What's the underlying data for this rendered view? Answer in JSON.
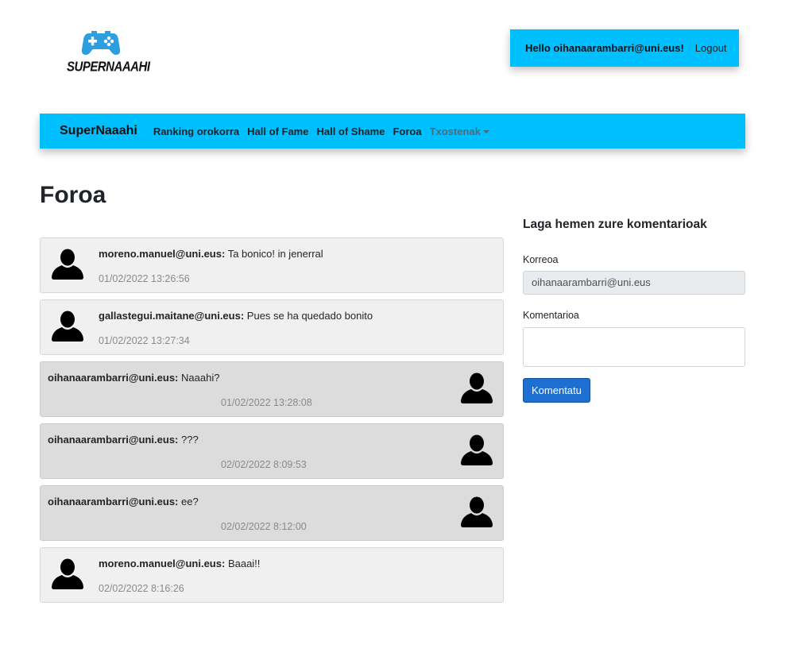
{
  "logo": {
    "text": "SUPERNAAAHI",
    "icon": "gamepad-icon",
    "color": "#2d9ee0"
  },
  "user": {
    "hello": "Hello oihanaarambarri@uni.eus!",
    "logout": "Logout"
  },
  "nav": {
    "brand": "SuperNaaahi",
    "links": [
      "Ranking orokorra",
      "Hall of Fame",
      "Hall of Shame",
      "Foroa"
    ],
    "dropdown": "Txostenak",
    "color": "#00bfff"
  },
  "page": {
    "title": "Foroa"
  },
  "posts": [
    {
      "author": "moreno.manuel@uni.eus:",
      "text": "Ta bonico! in jenerral",
      "time": "01/02/2022 13:26:56",
      "own": false
    },
    {
      "author": "gallastegui.maitane@uni.eus:",
      "text": "Pues se ha quedado bonito",
      "time": "01/02/2022 13:27:34",
      "own": false
    },
    {
      "author": "oihanaarambarri@uni.eus:",
      "text": "Naaahi?",
      "time": "01/02/2022 13:28:08",
      "own": true
    },
    {
      "author": "oihanaarambarri@uni.eus:",
      "text": "???",
      "time": "02/02/2022 8:09:53",
      "own": true
    },
    {
      "author": "oihanaarambarri@uni.eus:",
      "text": "ee?",
      "time": "02/02/2022 8:12:00",
      "own": true
    },
    {
      "author": "moreno.manuel@uni.eus:",
      "text": "Baaai!!",
      "time": "02/02/2022 8:16:26",
      "own": false
    }
  ],
  "form": {
    "title": "Laga hemen zure komentarioak",
    "email_label": "Korreoa",
    "email_value": "oihanaarambarri@uni.eus",
    "comment_label": "Komentarioa",
    "comment_value": "",
    "submit": "Komentatu",
    "button_color": "#1d6fd0"
  }
}
